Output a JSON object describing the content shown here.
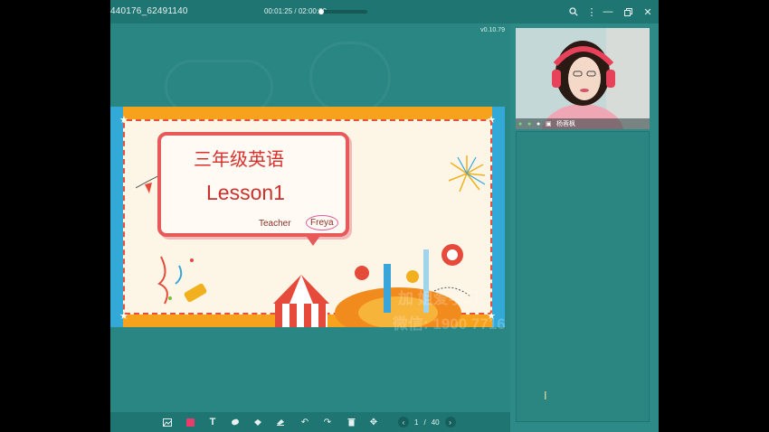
{
  "titlebar": {
    "session_id": "440176_62491140",
    "elapsed": "00:01:25",
    "separator": "/",
    "total": "02:00:00",
    "progress_fraction": 0.012
  },
  "board": {
    "version": "v0.10.79"
  },
  "slide": {
    "title_cn": "三年级英语",
    "lesson": "Lesson1",
    "teacher_label": "Teacher",
    "teacher_name": "Freya"
  },
  "toolbar": {
    "tools": [
      "image-icon",
      "color-swatch-icon",
      "text-icon",
      "eraser-icon",
      "shape-icon",
      "clear-icon",
      "undo-icon",
      "redo-icon",
      "trash-icon",
      "move-icon"
    ],
    "page_current": "1",
    "page_sep": "/",
    "page_total": "40",
    "accent": "#e83c6a"
  },
  "video": {
    "name": "杨蓉枫"
  },
  "watermark": {
    "line1": "加  姐爱学习",
    "line2": "微信: 1900 7716"
  },
  "colors": {
    "app_bg": "#2d8a86",
    "titlebar_bg": "#1f7571"
  }
}
